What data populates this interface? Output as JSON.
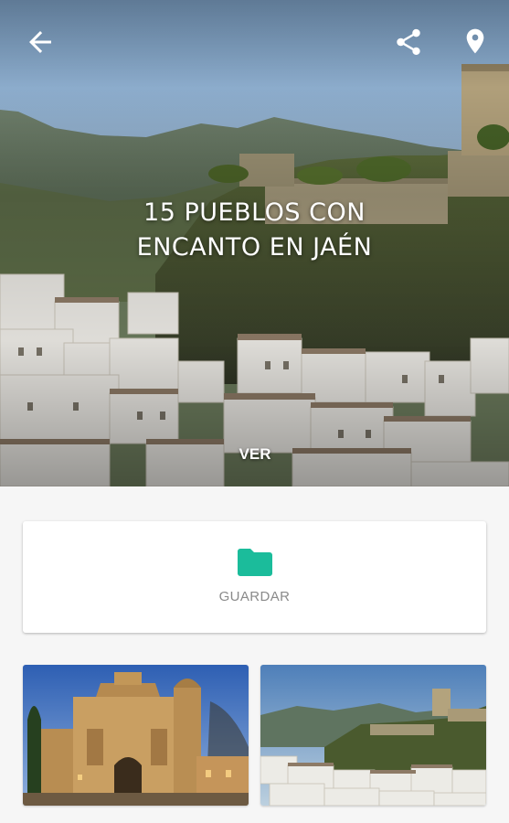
{
  "header": {
    "back_icon": "arrow-back-icon",
    "share_icon": "share-icon",
    "location_icon": "location-pin-icon",
    "icon_color": "#ffffff"
  },
  "hero": {
    "title": "15 PUEBLOS CON\nENCANTO EN JAÉN",
    "cta_label": "VER"
  },
  "save_card": {
    "icon": "folder-icon",
    "icon_color": "#1bbc9b",
    "label": "GUARDAR"
  },
  "gallery": {
    "items": [
      {
        "subject": "church-facade-photo"
      },
      {
        "subject": "hilltop-village-photo"
      }
    ]
  }
}
